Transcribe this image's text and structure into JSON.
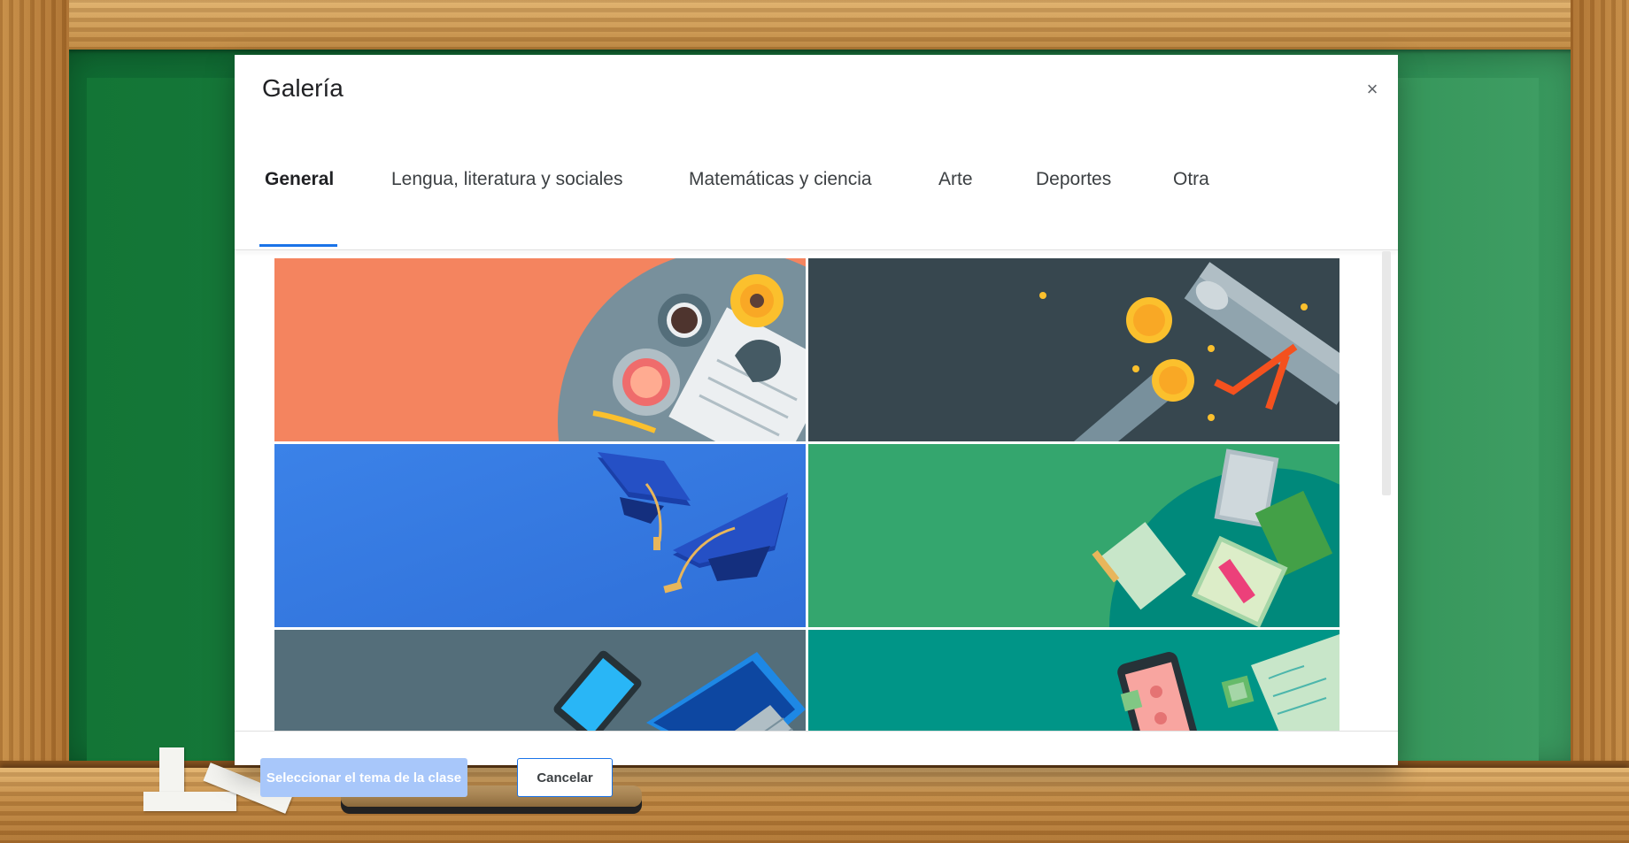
{
  "dialog": {
    "title": "Galería",
    "close_icon": "close-icon",
    "close_glyph": "×"
  },
  "tabs": [
    {
      "label": "General",
      "active": true
    },
    {
      "label": "Lengua, literatura y sociales",
      "active": false
    },
    {
      "label": "Matemáticas y ciencia",
      "active": false
    },
    {
      "label": "Arte",
      "active": false
    },
    {
      "label": "Deportes",
      "active": false
    },
    {
      "label": "Otra",
      "active": false
    }
  ],
  "themes": [
    {
      "name": "coffee-newspaper",
      "background": "#f4845f"
    },
    {
      "name": "diploma-coins",
      "background": "#37474f"
    },
    {
      "name": "graduation-caps",
      "background": "#3b82e8"
    },
    {
      "name": "books-notebooks",
      "background": "#34a66e"
    },
    {
      "name": "tablet-laptop",
      "background": "#546e7a"
    },
    {
      "name": "phone-documents",
      "background": "#009587"
    }
  ],
  "footer": {
    "select_label": "Seleccionar el tema de la clase",
    "cancel_label": "Cancelar"
  },
  "colors": {
    "accent": "#1a73e8",
    "select_button_disabled": "#a8c7fa"
  }
}
